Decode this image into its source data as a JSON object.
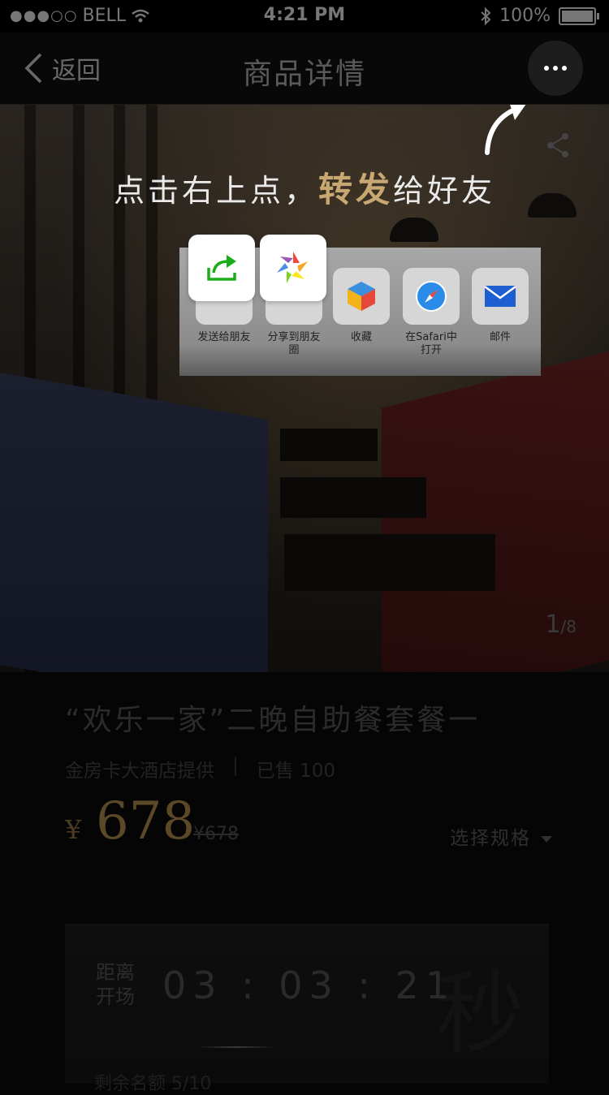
{
  "status_bar": {
    "signal": "●●●○○",
    "carrier": "BELL",
    "time": "4:21 PM",
    "battery": "100%"
  },
  "nav": {
    "back_label": "返回",
    "title": "商品详情"
  },
  "overlay": {
    "tip_part1": "点击右上点，",
    "tip_highlight": "转发",
    "tip_part2": "给好友",
    "share_items": [
      {
        "label": "发送给朋友",
        "icon": "forward-icon"
      },
      {
        "label": "分享到朋友圈",
        "icon": "moments-icon"
      },
      {
        "label": "收藏",
        "icon": "favorites-cube-icon"
      },
      {
        "label": "在Safari中打开",
        "icon": "safari-compass-icon"
      },
      {
        "label": "邮件",
        "icon": "mail-icon"
      }
    ]
  },
  "gallery": {
    "current": "1",
    "total": "/8"
  },
  "product": {
    "title": "“欢乐一家”二晚自助餐套餐一",
    "provider": "金房卡大酒店提供",
    "separator": "|",
    "sold": "已售 100",
    "currency": "¥",
    "price": "678",
    "original_price": "¥678",
    "spec_label": "选择规格"
  },
  "countdown": {
    "label": "距离开场",
    "time": "03 : 03 : 21",
    "remaining": "剩余名额 5/10"
  },
  "colors": {
    "gold": "#c8a872",
    "green": "#1aad19",
    "background": "#050505"
  }
}
